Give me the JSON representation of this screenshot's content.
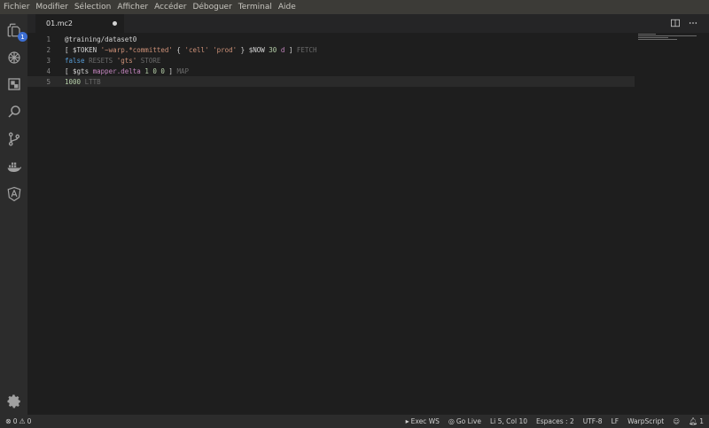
{
  "menubar": {
    "items": [
      "Fichier",
      "Modifier",
      "Sélection",
      "Afficher",
      "Accéder",
      "Déboguer",
      "Terminal",
      "Aide"
    ]
  },
  "activitybar": {
    "items": [
      {
        "name": "explorer-icon",
        "badge": "1"
      },
      {
        "name": "warp10-icon"
      },
      {
        "name": "extensions-icon"
      },
      {
        "name": "search-icon"
      },
      {
        "name": "source-control-icon"
      },
      {
        "name": "docker-icon"
      },
      {
        "name": "angular-icon"
      }
    ],
    "settings_icon": "gear-icon"
  },
  "tabs": [
    {
      "label": "01.mc2",
      "dirty": true
    }
  ],
  "editor": {
    "lines": [
      {
        "number": "1",
        "tokens": [
          {
            "text": "@training/dataset0",
            "kind": "default"
          }
        ]
      },
      {
        "number": "2",
        "tokens": [
          {
            "text": "[ ",
            "kind": "sym"
          },
          {
            "text": "$TOKEN",
            "kind": "default"
          },
          {
            "text": " ",
            "kind": "sym"
          },
          {
            "text": "'~warp.*committed'",
            "kind": "str"
          },
          {
            "text": " { ",
            "kind": "sym"
          },
          {
            "text": "'cell'",
            "kind": "str"
          },
          {
            "text": " ",
            "kind": "sym"
          },
          {
            "text": "'prod'",
            "kind": "str"
          },
          {
            "text": " } ",
            "kind": "sym"
          },
          {
            "text": "$NOW",
            "kind": "default"
          },
          {
            "text": " ",
            "kind": "sym"
          },
          {
            "text": "30",
            "kind": "num"
          },
          {
            "text": " ",
            "kind": "sym"
          },
          {
            "text": "d",
            "kind": "fn"
          },
          {
            "text": " ] ",
            "kind": "sym"
          },
          {
            "text": "FETCH",
            "kind": "kw"
          }
        ]
      },
      {
        "number": "3",
        "tokens": [
          {
            "text": "false",
            "kind": "bool"
          },
          {
            "text": " ",
            "kind": "sym"
          },
          {
            "text": "RESETS",
            "kind": "kw"
          },
          {
            "text": " ",
            "kind": "sym"
          },
          {
            "text": "'gts'",
            "kind": "str"
          },
          {
            "text": " ",
            "kind": "sym"
          },
          {
            "text": "STORE",
            "kind": "kw"
          }
        ]
      },
      {
        "number": "4",
        "tokens": [
          {
            "text": "[ ",
            "kind": "sym"
          },
          {
            "text": "$gts",
            "kind": "default"
          },
          {
            "text": " ",
            "kind": "sym"
          },
          {
            "text": "mapper.delta",
            "kind": "fn"
          },
          {
            "text": " ",
            "kind": "sym"
          },
          {
            "text": "1 0 0",
            "kind": "num"
          },
          {
            "text": " ] ",
            "kind": "sym"
          },
          {
            "text": "MAP",
            "kind": "kw"
          }
        ]
      },
      {
        "number": "5",
        "current": true,
        "tokens": [
          {
            "text": "1000",
            "kind": "num"
          },
          {
            "text": " ",
            "kind": "sym"
          },
          {
            "text": "LTTB",
            "kind": "kw"
          }
        ]
      }
    ]
  },
  "statusbar": {
    "errors": "0",
    "warnings": "0",
    "exec_ws": "Exec WS",
    "go_live": "Go Live",
    "position": "Li 5, Col 10",
    "spaces": "Espaces : 2",
    "encoding": "UTF-8",
    "eol": "LF",
    "language": "WarpScript",
    "notifications": "1"
  },
  "colors": {
    "menubar": "#3c3b37",
    "activitybar": "#2c2c2c",
    "editor": "#1e1e1e",
    "badge": "#3c6ed3"
  }
}
